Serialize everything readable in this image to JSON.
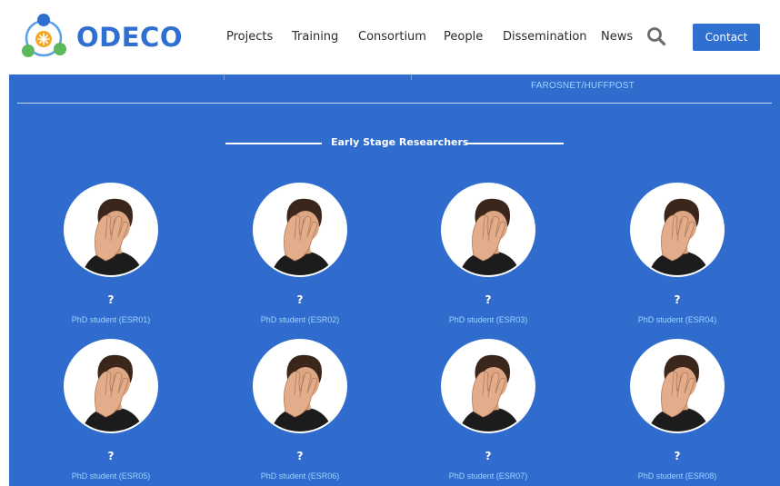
{
  "brand": {
    "name": "ODECO",
    "colors": {
      "primary": "#2f6fd0",
      "section_bg": "#2f6ccd",
      "accent_link": "#9fd4ff",
      "logo_orange": "#f5a623",
      "logo_green": "#5cb85c"
    }
  },
  "nav": {
    "items": [
      {
        "label": "Projects"
      },
      {
        "label": "Training"
      },
      {
        "label": "Consortium"
      },
      {
        "label": "People"
      },
      {
        "label": "Dissemination"
      },
      {
        "label": "News"
      }
    ],
    "search_icon": "search-icon",
    "contact_label": "Contact"
  },
  "credit_text": "FAROSNET/HUFFPOST",
  "section": {
    "title": "Early Stage Researchers"
  },
  "researchers": [
    {
      "name": "?",
      "role": "PhD student (ESR01)"
    },
    {
      "name": "?",
      "role": "PhD student (ESR02)"
    },
    {
      "name": "?",
      "role": "PhD student (ESR03)"
    },
    {
      "name": "?",
      "role": "PhD student (ESR04)"
    },
    {
      "name": "?",
      "role": "PhD student (ESR05)"
    },
    {
      "name": "?",
      "role": "PhD student (ESR06)"
    },
    {
      "name": "?",
      "role": "PhD student (ESR07)"
    },
    {
      "name": "?",
      "role": "PhD student (ESR08)"
    }
  ]
}
